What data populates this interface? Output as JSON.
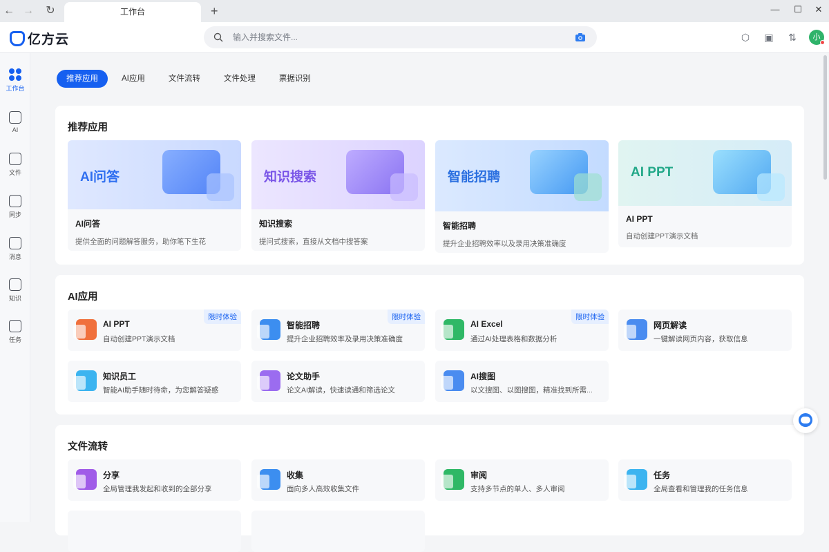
{
  "browser": {
    "tab_title": "工作台"
  },
  "header": {
    "logo_text": "亿方云",
    "search_placeholder": "输入并搜索文件...",
    "avatar_text": "小"
  },
  "sidebar": {
    "items": [
      {
        "label": "工作台",
        "icon": "grid-icon",
        "active": true
      },
      {
        "label": "AI",
        "icon": "ai-icon"
      },
      {
        "label": "文件",
        "icon": "folder-icon"
      },
      {
        "label": "同步",
        "icon": "sync-folder-icon"
      },
      {
        "label": "消息",
        "icon": "message-icon"
      },
      {
        "label": "知识",
        "icon": "knowledge-icon"
      },
      {
        "label": "任务",
        "icon": "task-icon"
      }
    ]
  },
  "content_tabs": [
    "推荐应用",
    "AI应用",
    "文件流转",
    "文件处理",
    "票据识别"
  ],
  "recommended": {
    "title": "推荐应用",
    "cards": [
      {
        "banner": "AI问答",
        "name": "AI问答",
        "desc": "提供全面的问题解答服务，助你笔下生花",
        "color": "#2f6ff0",
        "bg": "#dfe8ff"
      },
      {
        "banner": "知识搜索",
        "name": "知识搜索",
        "desc": "提问式搜索，直接从文档中搜答案",
        "color": "#7a56e8",
        "bg": "#ece6ff"
      },
      {
        "banner": "智能招聘",
        "name": "智能招聘",
        "desc": "提升企业招聘效率以及录用决策准确度",
        "color": "#2a6fe0",
        "bg": "#dbe9ff"
      },
      {
        "banner": "AI PPT",
        "name": "AI PPT",
        "desc": "自动创建PPT演示文档",
        "color": "#22a888",
        "bg": "#e0f4f1"
      }
    ]
  },
  "ai_apps": {
    "title": "AI应用",
    "badge": "限时体验",
    "items": [
      {
        "name": "AI PPT",
        "desc": "自动创建PPT演示文档",
        "badge": true,
        "color": "#f0703c"
      },
      {
        "name": "智能招聘",
        "desc": "提升企业招聘效率及录用决策准确度",
        "badge": true,
        "color": "#3c8ef0"
      },
      {
        "name": "AI Excel",
        "desc": "通过AI处理表格和数据分析",
        "badge": true,
        "color": "#2fb866"
      },
      {
        "name": "网页解读",
        "desc": "一键解读网页内容，获取信息",
        "badge": false,
        "color": "#4a8cf0"
      },
      {
        "name": "知识员工",
        "desc": "智能AI助手随时待命，为您解答疑惑",
        "badge": false,
        "color": "#3cb4f0"
      },
      {
        "name": "论文助手",
        "desc": "论文AI解读，快速读通和筛选论文",
        "badge": false,
        "color": "#9b6cf0"
      },
      {
        "name": "AI搜图",
        "desc": "以文搜图、以图搜图，精准找到所需...",
        "badge": false,
        "color": "#4a8cf0"
      }
    ]
  },
  "file_flow": {
    "title": "文件流转",
    "items": [
      {
        "name": "分享",
        "desc": "全局管理我发起和收到的全部分享",
        "color": "#a05ce8"
      },
      {
        "name": "收集",
        "desc": "面向多人高效收集文件",
        "color": "#3c8ef0"
      },
      {
        "name": "审阅",
        "desc": "支持多节点的单人、多人审阅",
        "color": "#2fb866"
      },
      {
        "name": "任务",
        "desc": "全局查看和管理我的任务信息",
        "color": "#3cb4f0"
      }
    ]
  }
}
